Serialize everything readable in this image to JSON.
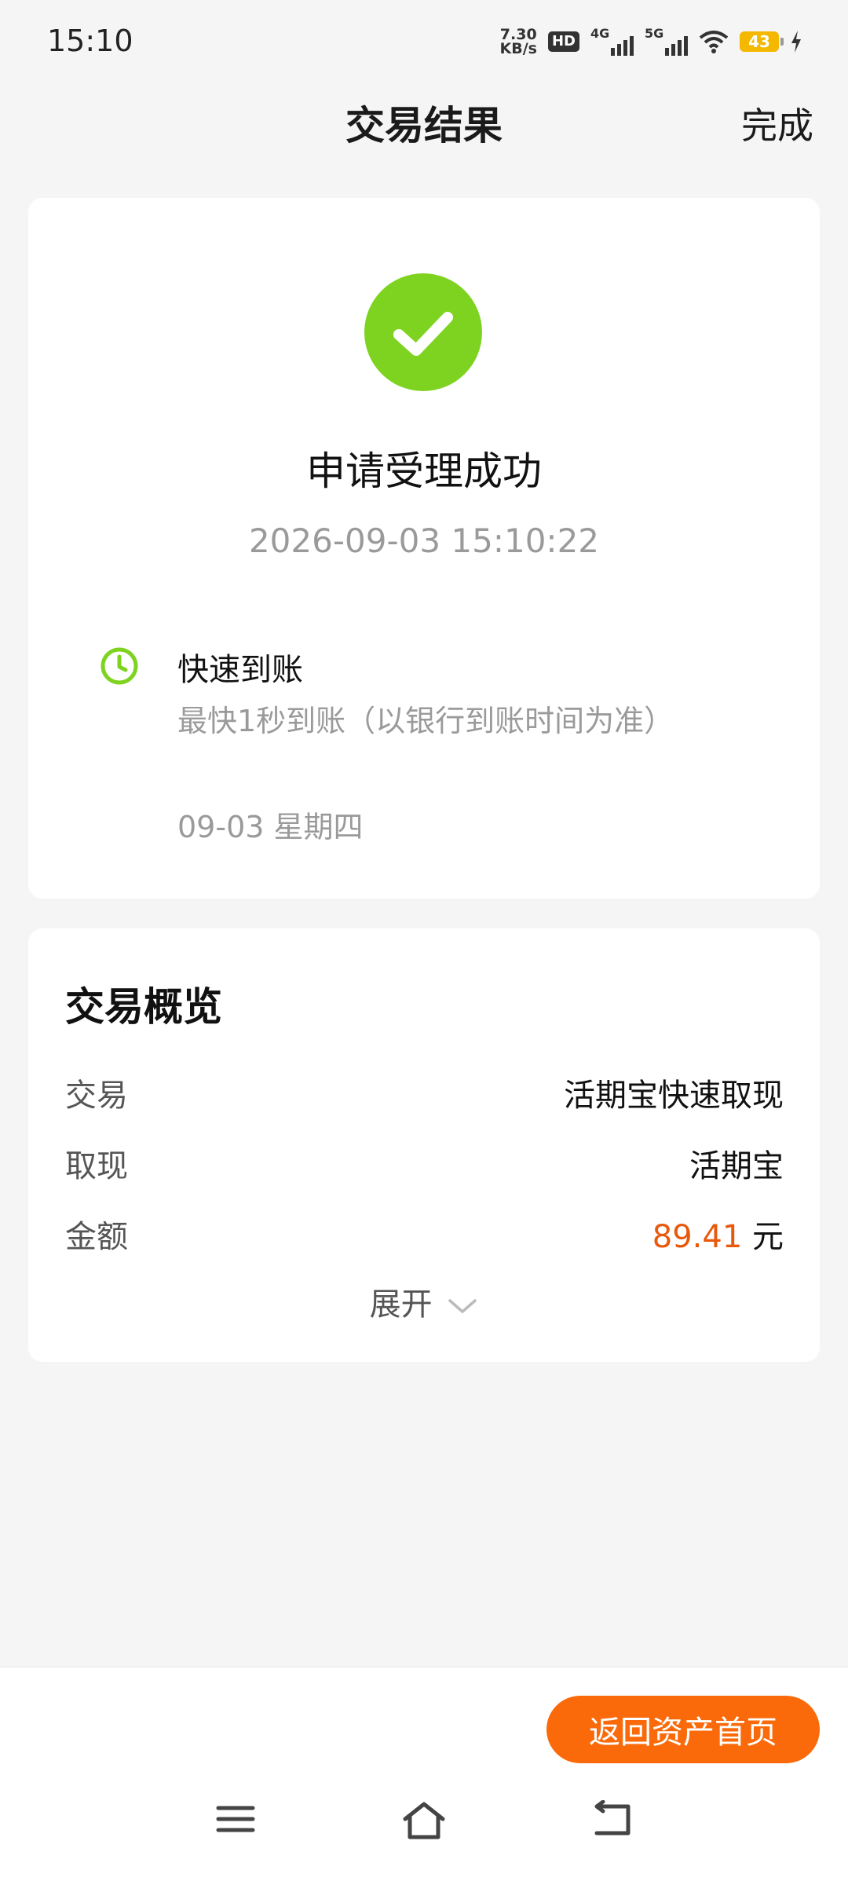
{
  "status_bar": {
    "time": "15:10",
    "net_speed_value": "7.30",
    "net_speed_unit": "KB/s",
    "hd_label": "HD",
    "sig1_label": "4G",
    "sig2_label": "5G",
    "battery": "43",
    "icons": [
      "hd-icon",
      "signal-4g-icon",
      "signal-5g-icon",
      "wifi-icon",
      "battery-icon",
      "charging-icon"
    ]
  },
  "header": {
    "title": "交易结果",
    "done_label": "完成"
  },
  "result": {
    "status_icon": "check-circle-icon",
    "title": "申请受理成功",
    "time": "2026-09-03 15:10:22",
    "arrival_icon": "clock-icon",
    "arrival_title": "快速到账",
    "arrival_desc": "最快1秒到账（以银行到账时间为准）",
    "arrival_date": "09-03 星期四"
  },
  "overview": {
    "title": "交易概览",
    "rows": [
      {
        "label": "交易",
        "value": "活期宝快速取现"
      },
      {
        "label": "取现",
        "value": "活期宝"
      },
      {
        "label": "金额",
        "amount": "89.41",
        "unit": "元"
      }
    ],
    "expand_label": "展开"
  },
  "actions": {
    "home_button": "返回资产首页"
  },
  "colors": {
    "accent": "#fa6a0a",
    "success": "#7ed321",
    "amount": "#e8590c"
  },
  "nav_bar": {
    "icons": [
      "menu-icon",
      "home-icon",
      "back-icon"
    ]
  }
}
